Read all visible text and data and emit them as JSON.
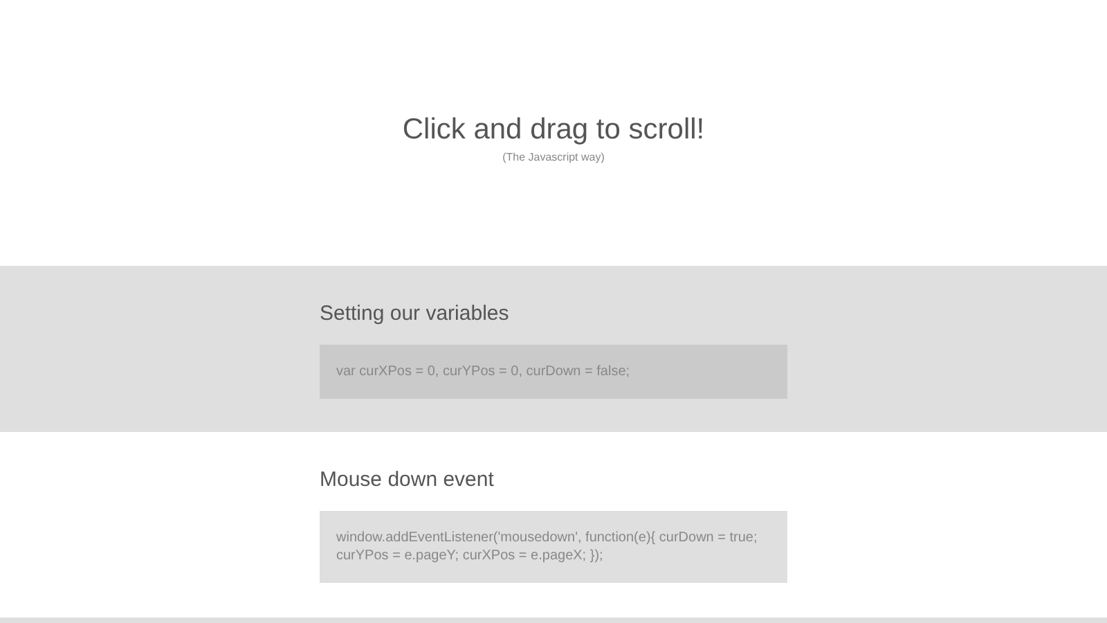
{
  "header": {
    "title": "Click and drag to scroll!",
    "subtitle": "(The Javascript way)"
  },
  "sections": [
    {
      "kind": "shaded",
      "heading": "Setting our variables",
      "code": "var curXPos = 0, curYPos = 0, curDown = false;"
    },
    {
      "kind": "plain",
      "heading": "Mouse down event",
      "code": "window.addEventListener('mousedown', function(e){ curDown = true; curYPos = e.pageY; curXPos = e.pageX; });"
    },
    {
      "kind": "shaded"
    }
  ]
}
